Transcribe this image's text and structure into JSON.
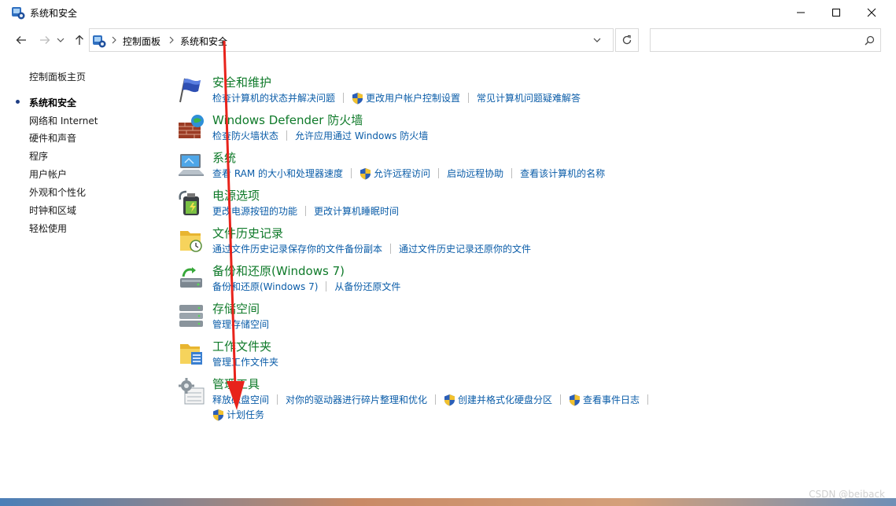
{
  "window": {
    "title": "系统和安全",
    "controls": [
      "minimize-icon",
      "maximize-icon",
      "close-icon"
    ]
  },
  "address": {
    "breadcrumbs": [
      "控制面板",
      "系统和安全"
    ],
    "search_placeholder": ""
  },
  "sidebar": {
    "items": [
      {
        "label": "控制面板主页",
        "active": false
      },
      {
        "label": "系统和安全",
        "active": true
      },
      {
        "label": "网络和 Internet",
        "active": false
      },
      {
        "label": "硬件和声音",
        "active": false
      },
      {
        "label": "程序",
        "active": false
      },
      {
        "label": "用户帐户",
        "active": false
      },
      {
        "label": "外观和个性化",
        "active": false
      },
      {
        "label": "时钟和区域",
        "active": false
      },
      {
        "label": "轻松使用",
        "active": false
      }
    ]
  },
  "categories": [
    {
      "title": "安全和维护",
      "icon": "flag-icon",
      "links": [
        {
          "text": "检查计算机的状态并解决问题",
          "shield": false
        },
        {
          "text": "更改用户帐户控制设置",
          "shield": true
        },
        {
          "text": "常见计算机问题疑难解答",
          "shield": false
        }
      ]
    },
    {
      "title": "Windows Defender 防火墙",
      "icon": "firewall-icon",
      "links": [
        {
          "text": "检查防火墙状态",
          "shield": false
        },
        {
          "text": "允许应用通过 Windows 防火墙",
          "shield": false
        }
      ]
    },
    {
      "title": "系统",
      "icon": "system-icon",
      "links": [
        {
          "text": "查看 RAM 的大小和处理器速度",
          "shield": false
        },
        {
          "text": "允许远程访问",
          "shield": true
        },
        {
          "text": "启动远程协助",
          "shield": false
        },
        {
          "text": "查看该计算机的名称",
          "shield": false
        }
      ]
    },
    {
      "title": "电源选项",
      "icon": "power-icon",
      "links": [
        {
          "text": "更改电源按钮的功能",
          "shield": false
        },
        {
          "text": "更改计算机睡眠时间",
          "shield": false
        }
      ]
    },
    {
      "title": "文件历史记录",
      "icon": "file-history-icon",
      "links": [
        {
          "text": "通过文件历史记录保存你的文件备份副本",
          "shield": false
        },
        {
          "text": "通过文件历史记录还原你的文件",
          "shield": false
        }
      ]
    },
    {
      "title": "备份和还原(Windows 7)",
      "icon": "backup-icon",
      "links": [
        {
          "text": "备份和还原(Windows 7)",
          "shield": false
        },
        {
          "text": "从备份还原文件",
          "shield": false
        }
      ]
    },
    {
      "title": "存储空间",
      "icon": "storage-icon",
      "links": [
        {
          "text": "管理存储空间",
          "shield": false
        }
      ]
    },
    {
      "title": "工作文件夹",
      "icon": "work-folders-icon",
      "links": [
        {
          "text": "管理工作文件夹",
          "shield": false
        }
      ]
    },
    {
      "title": "管理工具",
      "icon": "admin-tools-icon",
      "links": [
        {
          "text": "释放磁盘空间",
          "shield": false
        },
        {
          "text": "对你的驱动器进行碎片整理和优化",
          "shield": false
        },
        {
          "text": "创建并格式化硬盘分区",
          "shield": true
        },
        {
          "text": "查看事件日志",
          "shield": true
        }
      ],
      "links2": [
        {
          "text": "计划任务",
          "shield": true
        }
      ]
    }
  ],
  "watermark": "CSDN @beiback",
  "colors": {
    "title_green": "#0f7a2a",
    "link_blue": "#0a5ca8",
    "annotation_red": "#e8231b"
  }
}
